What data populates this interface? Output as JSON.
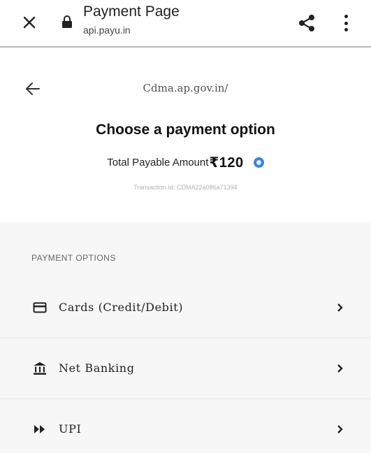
{
  "browser": {
    "page_title": "Payment Page",
    "url": "api.payu.in",
    "icons": {
      "close": "close-icon",
      "lock": "lock-icon",
      "share": "share-icon",
      "more": "more-vert-icon"
    }
  },
  "header": {
    "merchant": "Cdma.ap.gov.in/",
    "title": "Choose a payment option",
    "amount_label": "Total Payable Amount",
    "amount_value": "₹120",
    "transaction_id": "Transaction Id: CDMA22a086a71394",
    "accent_color": "#3b82e0"
  },
  "payment_options": {
    "heading": "PAYMENT OPTIONS",
    "items": [
      {
        "label": "Cards (Credit/Debit)",
        "icon": "card-icon"
      },
      {
        "label": "Net Banking",
        "icon": "bank-icon"
      },
      {
        "label": "UPI",
        "icon": "upi-icon"
      }
    ]
  }
}
